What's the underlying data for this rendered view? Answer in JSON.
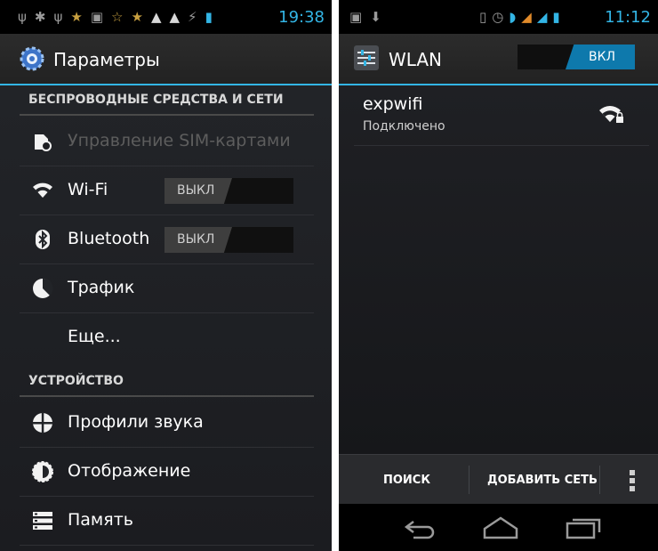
{
  "left": {
    "status": {
      "time": "19:38"
    },
    "title": "Параметры",
    "sections": [
      {
        "header": "БЕСПРОВОДНЫЕ СРЕДСТВА И СЕТИ"
      },
      {
        "header": "УСТРОЙСТВО"
      }
    ],
    "items": {
      "sim": {
        "label": "Управление SIM-картами"
      },
      "wifi": {
        "label": "Wi-Fi",
        "toggle": "ВЫКЛ"
      },
      "bluetooth": {
        "label": "Bluetooth",
        "toggle": "ВЫКЛ"
      },
      "traffic": {
        "label": "Трафик"
      },
      "more": {
        "label": "Еще..."
      },
      "sound": {
        "label": "Профили звука"
      },
      "display": {
        "label": "Отображение"
      },
      "storage": {
        "label": "Память"
      }
    }
  },
  "right": {
    "status": {
      "time": "11:12"
    },
    "title": "WLAN",
    "master_toggle": "ВКЛ",
    "networks": [
      {
        "name": "expwifi",
        "status": "Подключено"
      }
    ],
    "bottom_actions": {
      "search": "ПОИСК",
      "add": "ДОБАВИТЬ СЕТЬ"
    }
  },
  "colors": {
    "accent": "#33b5e5",
    "toggle_on": "#0e79ac",
    "background": "#1b1c20"
  },
  "icons": [
    "usb-icon",
    "android-debug-icon",
    "star-icon",
    "image-icon",
    "warning-icon",
    "charging-icon",
    "battery-icon",
    "settings-gear-icon",
    "sim-icon",
    "wifi-icon",
    "bluetooth-icon",
    "traffic-icon",
    "sound-icon",
    "display-icon",
    "storage-icon",
    "wlan-settings-icon",
    "alarm-icon",
    "signal-icon",
    "wifi-lock-icon",
    "overflow-menu-icon",
    "back-icon",
    "home-icon",
    "recent-apps-icon"
  ]
}
